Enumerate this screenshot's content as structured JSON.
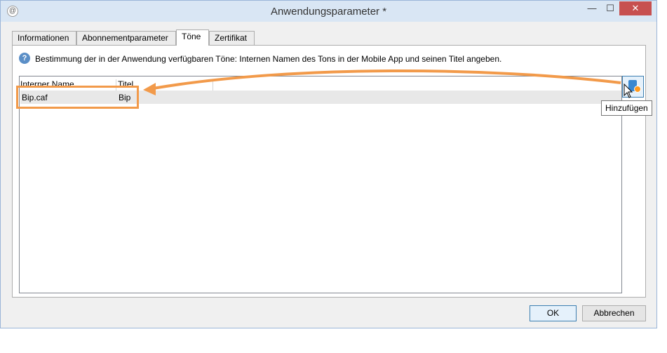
{
  "window": {
    "title": "Anwendungsparameter *",
    "min": "—",
    "max": "☐",
    "close": "✕"
  },
  "tabs": [
    {
      "label": "Informationen"
    },
    {
      "label": "Abonnementparameter"
    },
    {
      "label": "Töne"
    },
    {
      "label": "Zertifikat"
    }
  ],
  "panel": {
    "description": "Bestimmung der in der Anwendung verfügbaren Töne: Internen Namen des Tons in der Mobile App und seinen Titel angeben."
  },
  "grid": {
    "columns": [
      "Interner Name",
      "Titel"
    ],
    "rows": [
      {
        "name": "Bip.caf",
        "title": "Bip"
      }
    ]
  },
  "add_button": {
    "tooltip": "Hinzufügen"
  },
  "buttons": {
    "ok": "OK",
    "cancel": "Abbrechen"
  },
  "colors": {
    "accent": "#3c7fb1",
    "annotation": "#f29a4a",
    "titlebar": "#d9e6f4"
  }
}
